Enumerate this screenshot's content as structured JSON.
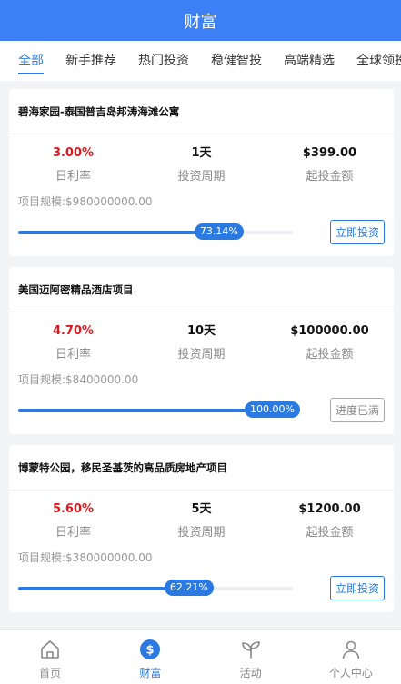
{
  "header": {
    "title": "财富"
  },
  "tabs": [
    {
      "label": "全部",
      "active": true
    },
    {
      "label": "新手推荐"
    },
    {
      "label": "热门投资"
    },
    {
      "label": "稳健智投"
    },
    {
      "label": "高端精选"
    },
    {
      "label": "全球领投"
    }
  ],
  "labels": {
    "rate": "日利率",
    "period": "投资周期",
    "min": "起投金额"
  },
  "projects": [
    {
      "title": "碧海家园-泰国普吉岛邦涛海滩公寓",
      "rate": "3.00%",
      "period": "1天",
      "min": "$399.00",
      "scale": "项目规模:$980000000.00",
      "progress_label": "73.14%",
      "progress": 73.14,
      "button": "立即投资",
      "full": false
    },
    {
      "title": "美国迈阿密精品酒店项目",
      "rate": "4.70%",
      "period": "10天",
      "min": "$100000.00",
      "scale": "项目规模:$8400000.00",
      "progress_label": "100.00%",
      "progress": 100,
      "button": "进度已满",
      "full": true
    },
    {
      "title": "博蒙特公园，移民圣基茨的高品质房地产项目",
      "rate": "5.60%",
      "period": "5天",
      "min": "$1200.00",
      "scale": "项目规模:$380000000.00",
      "progress_label": "62.21%",
      "progress": 62.21,
      "button": "立即投资",
      "full": false
    }
  ],
  "tabbar": [
    {
      "label": "首页",
      "icon": "home-icon"
    },
    {
      "label": "财富",
      "icon": "wealth-icon",
      "active": true
    },
    {
      "label": "活动",
      "icon": "sprout-icon"
    },
    {
      "label": "个人中心",
      "icon": "user-icon"
    }
  ],
  "colors": {
    "primary": "#3d7ff5",
    "accent": "#2a7ae2",
    "rate": "#e0161f"
  }
}
